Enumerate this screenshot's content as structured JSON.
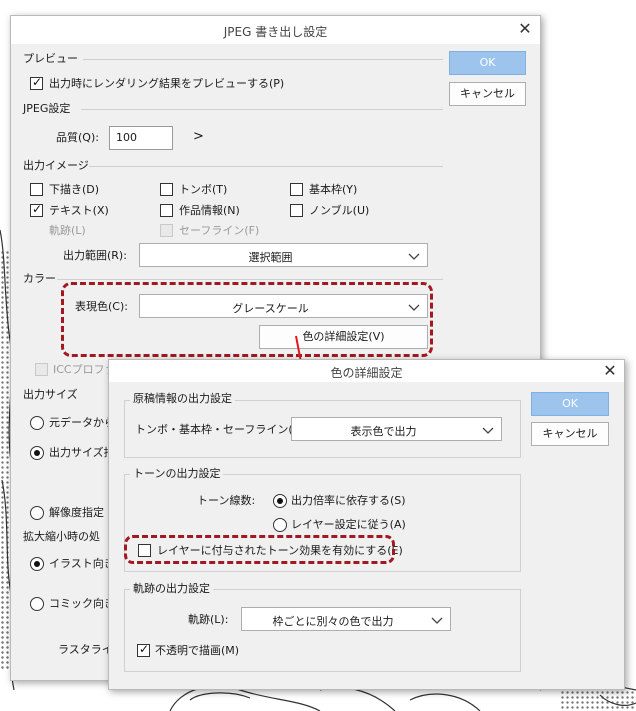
{
  "main_dialog": {
    "title": "JPEG 書き出し設定",
    "ok_label": "OK",
    "cancel_label": "キャンセル",
    "preview": {
      "section": "プレビュー",
      "render_preview_label": "出力時にレンダリング結果をプレビューする(P)",
      "render_preview_checked": true
    },
    "jpeg": {
      "section": "JPEG設定",
      "quality_label": "品質(Q):",
      "quality_value": "100",
      "arrow": ">"
    },
    "output_image": {
      "section": "出力イメージ",
      "draft_label": "下描き(D)",
      "text_label": "テキスト(X)",
      "trace_label": "軌跡(L)",
      "tombo_label": "トンボ(T)",
      "work_info_label": "作品情報(N)",
      "safe_line_label": "セーフライン(F)",
      "base_frame_label": "基本枠(Y)",
      "nombre_label": "ノンブル(U)",
      "range_label": "出力範囲(R):",
      "range_value": "選択範囲"
    },
    "color": {
      "section": "カラー",
      "expression_label": "表現色(C):",
      "expression_value": "グレースケール",
      "detail_button": "色の詳細設定(V)",
      "icc_label": "ICCプロファ"
    },
    "output_size": {
      "section": "出力サイズ",
      "from_original": "元データから",
      "by_output_size": "出力サイズ指",
      "by_resolution": "解像度指定"
    },
    "scaling": {
      "section": "拡大縮小時の処",
      "illustration": "イラスト向き(",
      "comic": "コミック向き(C",
      "rasterize": "ラスタライズ"
    }
  },
  "detail_dialog": {
    "title": "色の詳細設定",
    "ok_label": "OK",
    "cancel_label": "キャンセル",
    "manuscript": {
      "section": "原稿情報の出力設定",
      "label": "トンボ・基本枠・セーフライン(T):",
      "value": "表示色で出力"
    },
    "tone": {
      "section": "トーンの出力設定",
      "lines_label": "トーン線数:",
      "opt_scale": "出力倍率に依存する(S)",
      "opt_layer": "レイヤー設定に従う(A)",
      "enable_effect_label": "レイヤーに付与されたトーン効果を有効にする(E)"
    },
    "trace": {
      "section": "軌跡の出力設定",
      "label": "軌跡(L):",
      "value": "枠ごとに別々の色で出力",
      "opaque_label": "不透明で描画(M)"
    }
  },
  "colors": {
    "highlight": "#a11a22",
    "arrow": "#e0161f",
    "primary_button": "#9cc4ed"
  }
}
